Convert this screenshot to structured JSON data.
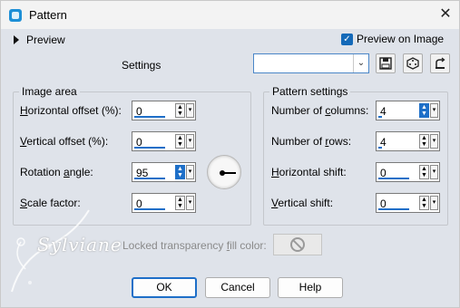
{
  "window": {
    "title": "Pattern",
    "close_glyph": "✕"
  },
  "preview": {
    "label": "Preview",
    "on_image_label": "Preview on Image",
    "on_image_checked": true
  },
  "settings": {
    "label": "Settings",
    "preset_value": ""
  },
  "image_area": {
    "title": "Image area",
    "horizontal_offset": {
      "label_key": "H",
      "label_rest": "orizontal offset (%):",
      "value": "0"
    },
    "vertical_offset": {
      "label_key": "V",
      "label_rest": "ertical offset (%):",
      "value": "0"
    },
    "rotation_angle": {
      "label_pre": "Rotation ",
      "label_key": "a",
      "label_rest": "ngle:",
      "value": "95"
    },
    "scale_factor": {
      "label_key": "S",
      "label_rest": "cale factor:",
      "value": "0"
    }
  },
  "pattern_settings": {
    "title": "Pattern settings",
    "columns": {
      "label_pre": "Number of ",
      "label_key": "c",
      "label_rest": "olumns:",
      "value": "4"
    },
    "rows": {
      "label_pre": "Number of ",
      "label_key": "r",
      "label_rest": "ows:",
      "value": "4"
    },
    "horizontal_shift": {
      "label_key": "H",
      "label_rest": "orizontal shift:",
      "value": "0"
    },
    "vertical_shift": {
      "label_key": "V",
      "label_rest": "ertical shift:",
      "value": "0"
    }
  },
  "locked_fill": {
    "label_pre": "Locked transparency ",
    "label_key": "f",
    "label_rest": "ill color:"
  },
  "buttons": {
    "ok": "OK",
    "cancel": "Cancel",
    "help": "Help"
  },
  "watermark": "Sylviane",
  "colors": {
    "accent": "#1e6fc8",
    "background": "#dfe3ea"
  }
}
